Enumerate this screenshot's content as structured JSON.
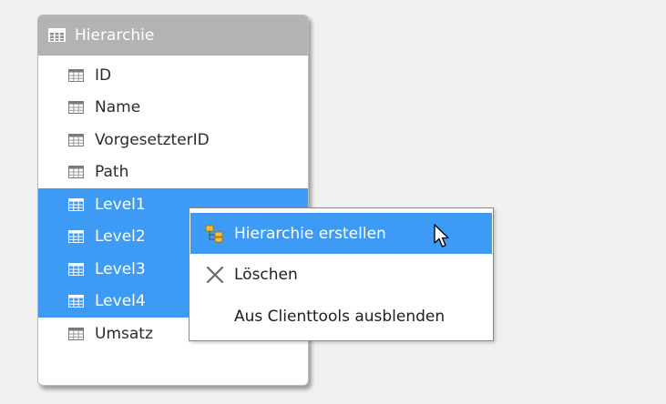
{
  "table": {
    "title": "Hierarchie",
    "icon": "table-icon",
    "columns": [
      {
        "label": "ID",
        "selected": false
      },
      {
        "label": "Name",
        "selected": false
      },
      {
        "label": "VorgesetzterID",
        "selected": false
      },
      {
        "label": "Path",
        "selected": false
      },
      {
        "label": "Level1",
        "selected": true
      },
      {
        "label": "Level2",
        "selected": true
      },
      {
        "label": "Level3",
        "selected": true
      },
      {
        "label": "Level4",
        "selected": true
      },
      {
        "label": "Umsatz",
        "selected": false
      }
    ]
  },
  "context_menu": {
    "items": [
      {
        "label": "Hierarchie erstellen",
        "icon": "hierarchy-icon",
        "highlighted": true
      },
      {
        "label": "Löschen",
        "icon": "delete-x-icon",
        "highlighted": false
      },
      {
        "label": "Aus Clienttools ausblenden",
        "icon": "",
        "highlighted": false
      }
    ]
  },
  "colors": {
    "selection": "#3d9bf5",
    "header_bg": "#b3b3b3",
    "background": "#f0f0f0"
  }
}
